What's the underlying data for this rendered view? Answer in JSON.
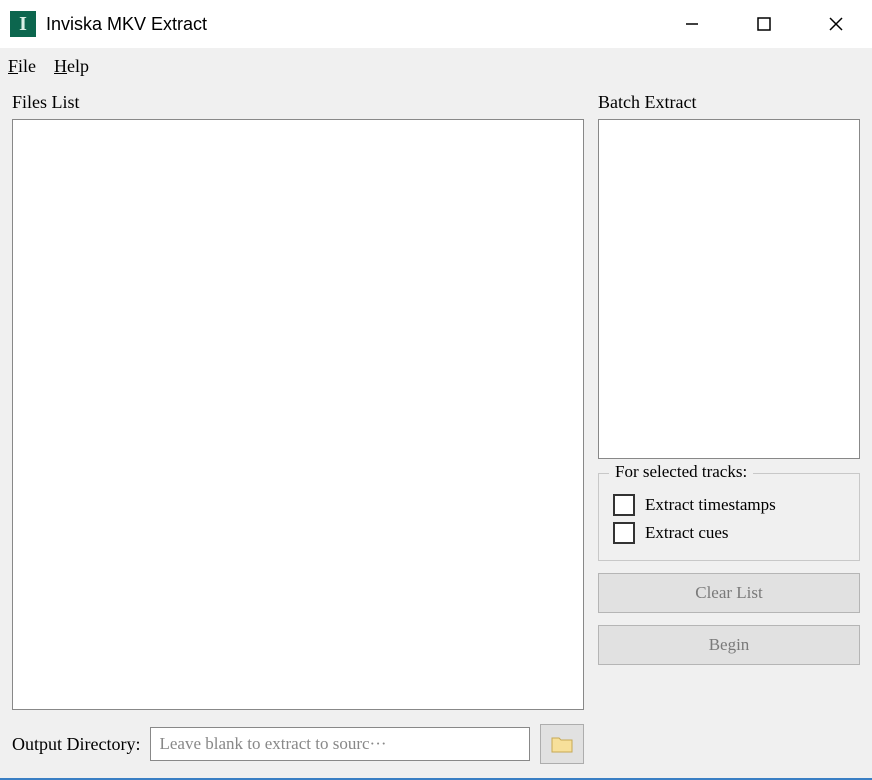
{
  "window": {
    "title": "Inviska MKV Extract",
    "app_icon_letter": "I"
  },
  "menubar": {
    "file": "File",
    "help": "Help"
  },
  "main": {
    "files_list_label": "Files List",
    "batch_extract_label": "Batch Extract",
    "group_title": "For selected tracks:",
    "extract_timestamps_label": "Extract timestamps",
    "extract_cues_label": "Extract cues",
    "clear_list_label": "Clear List",
    "begin_label": "Begin",
    "output_directory_label": "Output Directory:",
    "output_directory_placeholder": "Leave blank to extract to sourc···"
  }
}
